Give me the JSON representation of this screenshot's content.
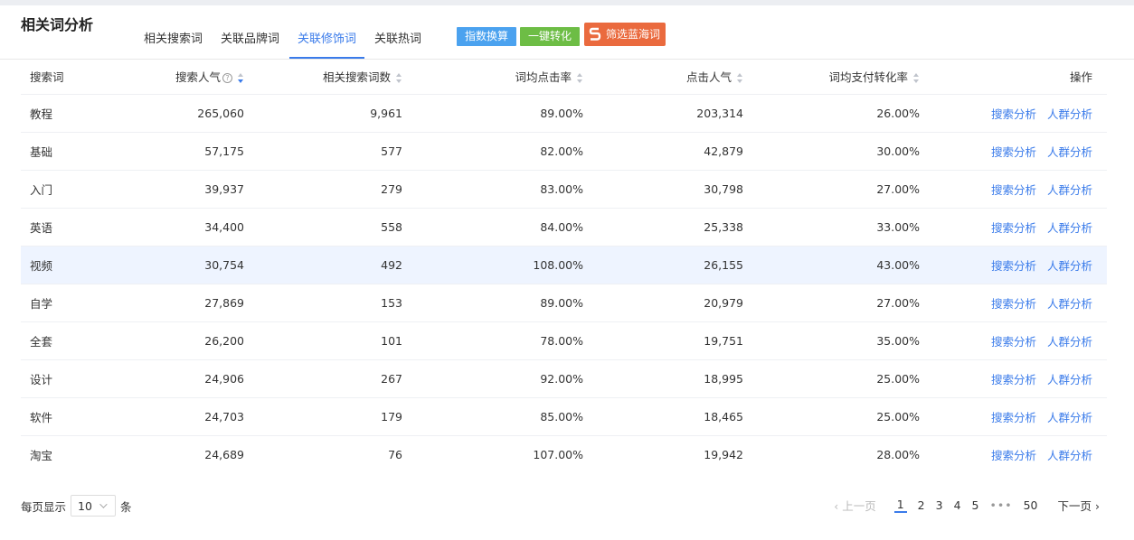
{
  "page": {
    "title": "相关词分析"
  },
  "tabs": [
    {
      "label": "相关搜索词"
    },
    {
      "label": "关联品牌词"
    },
    {
      "label": "关联修饰词",
      "active": true
    },
    {
      "label": "关联热词"
    }
  ],
  "actions": {
    "index_convert": "指数换算",
    "one_click_convert": "一键转化",
    "filter_blue_ocean": "筛选蓝海词"
  },
  "table": {
    "headers": [
      "搜索词",
      "搜索人气",
      "相关搜索词数",
      "词均点击率",
      "点击人气",
      "词均支付转化率",
      "操作"
    ],
    "sort": {
      "column": "搜索人气",
      "direction": "desc"
    },
    "rows": [
      {
        "term": "教程",
        "popularity": "265,060",
        "related": "9,961",
        "ctr": "89.00%",
        "click_pop": "203,314",
        "conv": "26.00%"
      },
      {
        "term": "基础",
        "popularity": "57,175",
        "related": "577",
        "ctr": "82.00%",
        "click_pop": "42,879",
        "conv": "30.00%"
      },
      {
        "term": "入门",
        "popularity": "39,937",
        "related": "279",
        "ctr": "83.00%",
        "click_pop": "30,798",
        "conv": "27.00%"
      },
      {
        "term": "英语",
        "popularity": "34,400",
        "related": "558",
        "ctr": "84.00%",
        "click_pop": "25,338",
        "conv": "33.00%"
      },
      {
        "term": "视频",
        "popularity": "30,754",
        "related": "492",
        "ctr": "108.00%",
        "click_pop": "26,155",
        "conv": "43.00%",
        "highlight": true
      },
      {
        "term": "自学",
        "popularity": "27,869",
        "related": "153",
        "ctr": "89.00%",
        "click_pop": "20,979",
        "conv": "27.00%"
      },
      {
        "term": "全套",
        "popularity": "26,200",
        "related": "101",
        "ctr": "78.00%",
        "click_pop": "19,751",
        "conv": "35.00%"
      },
      {
        "term": "设计",
        "popularity": "24,906",
        "related": "267",
        "ctr": "92.00%",
        "click_pop": "18,995",
        "conv": "25.00%"
      },
      {
        "term": "软件",
        "popularity": "24,703",
        "related": "179",
        "ctr": "85.00%",
        "click_pop": "18,465",
        "conv": "25.00%"
      },
      {
        "term": "淘宝",
        "popularity": "24,689",
        "related": "76",
        "ctr": "107.00%",
        "click_pop": "19,942",
        "conv": "28.00%"
      }
    ],
    "row_actions": [
      "搜索分析",
      "人群分析"
    ]
  },
  "pagination": {
    "per_page_label": "每页显示",
    "per_page_value": "10",
    "per_page_unit": "条",
    "prev_label": "上一页",
    "next_label": "下一页",
    "pages": [
      "1",
      "2",
      "3",
      "4",
      "5"
    ],
    "ellipsis": "•••",
    "last_page": "50",
    "current": "1"
  },
  "colors": {
    "accent": "#3a7bea",
    "btn_index": "#4ba2ef",
    "btn_convert": "#6dbd45",
    "btn_blue_ocean": "#ea6a3e",
    "row_highlight": "#eef4ff"
  },
  "icons": {
    "help": "question-circle-icon",
    "sort": "sort-caret-icon",
    "chevron": "chevron-down-icon",
    "brand": "s-logo-icon"
  }
}
